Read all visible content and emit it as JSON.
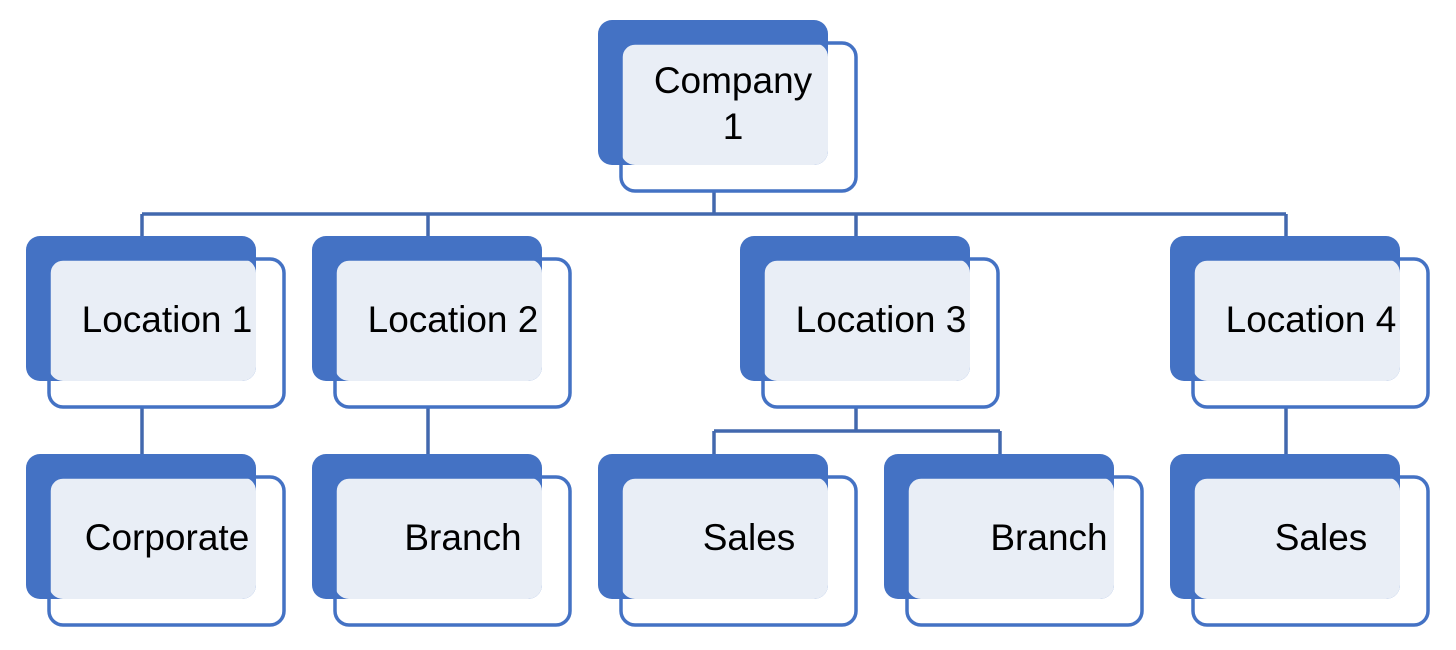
{
  "diagram": {
    "type": "org-chart",
    "colors": {
      "accent": "#4472C4",
      "fill_light": "#E9EEF6",
      "connector": "#4268AE",
      "text": "#000000"
    },
    "nodes": [
      {
        "id": "company1",
        "label": "Company 1",
        "level": 1,
        "parent": null
      },
      {
        "id": "location1",
        "label": "Location 1",
        "level": 2,
        "parent": "company1"
      },
      {
        "id": "location2",
        "label": "Location 2",
        "level": 2,
        "parent": "company1"
      },
      {
        "id": "location3",
        "label": "Location 3",
        "level": 2,
        "parent": "company1"
      },
      {
        "id": "location4",
        "label": "Location 4",
        "level": 2,
        "parent": "company1"
      },
      {
        "id": "corporate",
        "label": "Corporate",
        "level": 3,
        "parent": "location1"
      },
      {
        "id": "branch2",
        "label": "Branch",
        "level": 3,
        "parent": "location2"
      },
      {
        "id": "sales3",
        "label": "Sales",
        "level": 3,
        "parent": "location3"
      },
      {
        "id": "branch3",
        "label": "Branch",
        "level": 3,
        "parent": "location3"
      },
      {
        "id": "sales4",
        "label": "Sales",
        "level": 3,
        "parent": "location4"
      }
    ]
  }
}
